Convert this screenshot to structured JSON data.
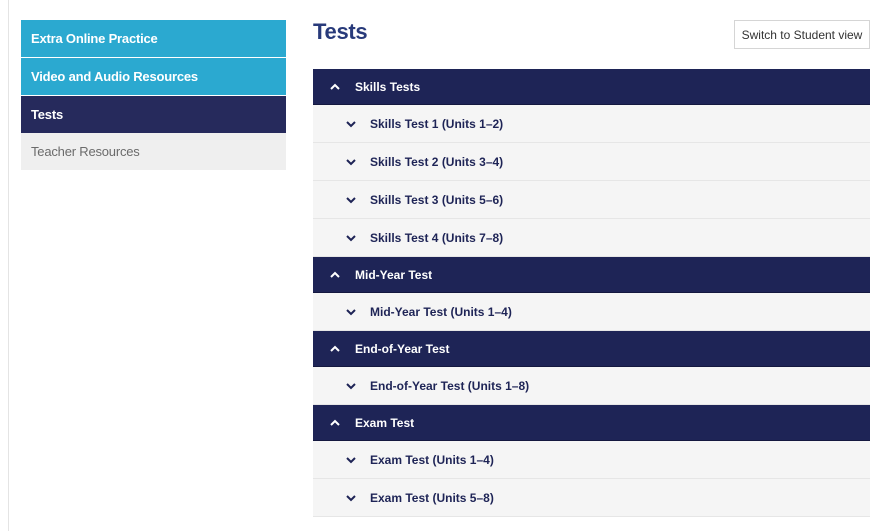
{
  "sidebar": {
    "items": [
      {
        "label": "Extra Online Practice",
        "style": "cyan"
      },
      {
        "label": "Video and Audio Resources",
        "style": "cyan"
      },
      {
        "label": "Tests",
        "style": "active"
      },
      {
        "label": "Teacher Resources",
        "style": "plain"
      }
    ]
  },
  "page": {
    "title": "Tests",
    "switch_label": "Switch to Student view"
  },
  "sections": [
    {
      "label": "Skills Tests",
      "items": [
        "Skills Test 1 (Units 1–2)",
        "Skills Test 2 (Units 3–4)",
        "Skills Test 3 (Units 5–6)",
        "Skills Test 4 (Units 7–8)"
      ]
    },
    {
      "label": "Mid-Year Test",
      "items": [
        "Mid-Year Test (Units 1–4)"
      ]
    },
    {
      "label": "End-of-Year Test",
      "items": [
        "End-of-Year Test (Units 1–8)"
      ]
    },
    {
      "label": "Exam Test",
      "items": [
        "Exam Test (Units 1–4)",
        "Exam Test (Units 5–8)"
      ]
    }
  ],
  "icons": {
    "section": "chevron-up-icon",
    "item": "chevron-down-icon"
  },
  "colors": {
    "cyan": "#2ba9d0",
    "navy": "#1e2456",
    "title": "#283a7a"
  }
}
